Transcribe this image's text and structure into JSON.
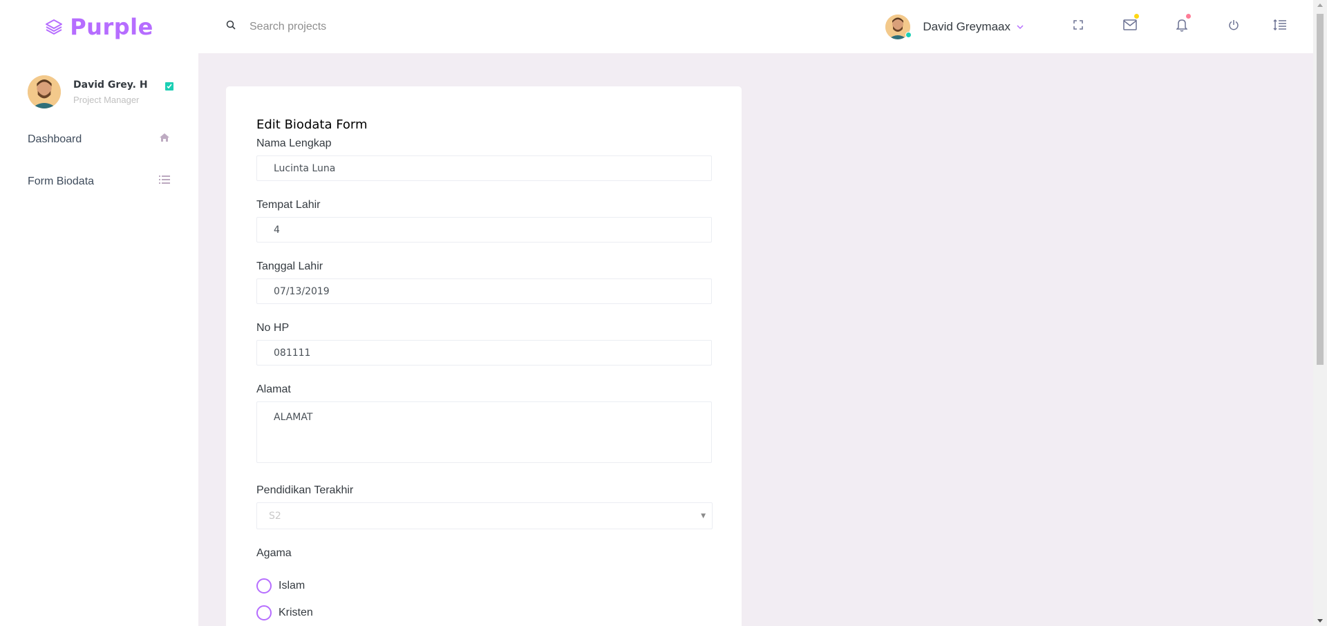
{
  "brand": {
    "name": "Purple",
    "color": "#b66dff"
  },
  "search": {
    "placeholder": "Search projects",
    "icon": "search-icon"
  },
  "topbar": {
    "user_name": "David Greymaax",
    "icons": [
      "fullscreen-icon",
      "mail-icon",
      "bell-icon",
      "power-icon",
      "menu-icon"
    ],
    "mail_badge_color": "#fed713",
    "bell_badge_color": "#fe7c96"
  },
  "sidebar": {
    "profile": {
      "name": "David Grey. H",
      "role": "Project Manager"
    },
    "items": [
      {
        "label": "Dashboard",
        "icon": "home-icon"
      },
      {
        "label": "Form Biodata",
        "icon": "list-icon"
      }
    ]
  },
  "form": {
    "title": "Edit Biodata Form",
    "fields": {
      "nama": {
        "label": "Nama Lengkap",
        "value": "Lucinta Luna"
      },
      "tempat": {
        "label": "Tempat Lahir",
        "value": "4"
      },
      "tanggal": {
        "label": "Tanggal Lahir",
        "value": "07/13/2019"
      },
      "hp": {
        "label": "No HP",
        "value": "081111"
      },
      "alamat": {
        "label": "Alamat",
        "value": "ALAMAT"
      },
      "pendidikan": {
        "label": "Pendidikan Terakhir",
        "value": "S2"
      },
      "agama": {
        "label": "Agama",
        "options": [
          "Islam",
          "Kristen"
        ]
      }
    }
  }
}
